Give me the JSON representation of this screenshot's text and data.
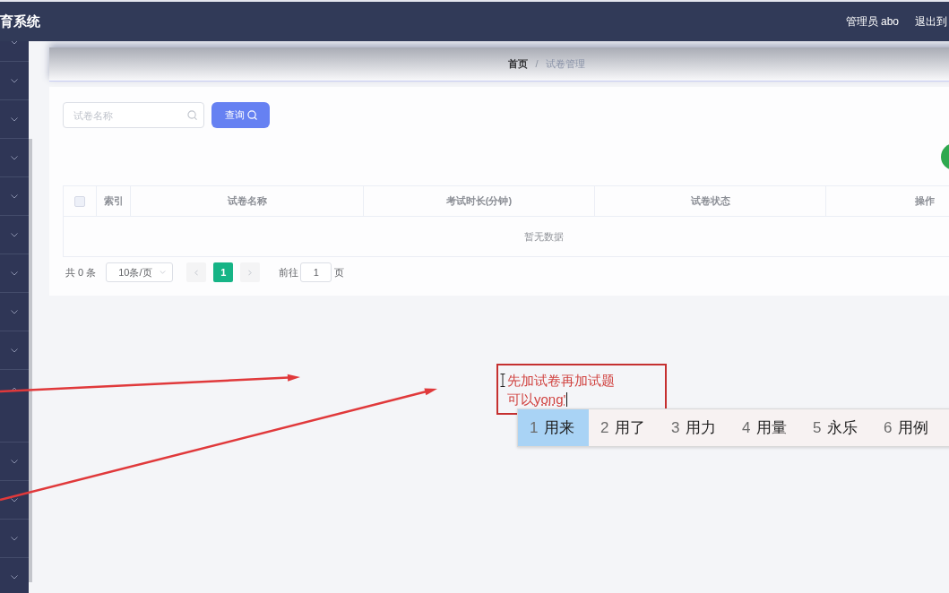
{
  "header": {
    "title": "育系统",
    "user": "管理员 abo",
    "logout": "退出到"
  },
  "sidebar": {
    "items": [
      {
        "expanded": false
      },
      {
        "expanded": false
      },
      {
        "expanded": false
      },
      {
        "expanded": false
      },
      {
        "expanded": false
      },
      {
        "expanded": false
      },
      {
        "expanded": false
      },
      {
        "expanded": false
      },
      {
        "expanded": false
      },
      {
        "expanded": true
      },
      {
        "expanded": false
      },
      {
        "expanded": false
      },
      {
        "expanded": false
      },
      {
        "expanded": false
      }
    ]
  },
  "breadcrumb": {
    "items": [
      "首页",
      "试卷管理"
    ],
    "separator": "/"
  },
  "search": {
    "placeholder": "试卷名称",
    "button": "查询"
  },
  "table": {
    "select_all": {
      "checked": false
    },
    "columns": [
      "索引",
      "试卷名称",
      "考试时长(分钟)",
      "试卷状态",
      "操作"
    ],
    "empty_text": "暂无数据"
  },
  "pagination": {
    "total": "共 0 条",
    "page_size": "10条/页",
    "pages": [
      {
        "label": "1",
        "selected": true
      }
    ],
    "goto_label": "前往",
    "goto_value": "1",
    "goto_unit": "页"
  },
  "annotation": {
    "lines": [
      "先加试卷再加试题",
      "可以"
    ],
    "composing": "yong'"
  },
  "ime_candidates": [
    {
      "number": "1",
      "text": "用来",
      "selected": true
    },
    {
      "number": "2",
      "text": "用了",
      "selected": false
    },
    {
      "number": "3",
      "text": "用力",
      "selected": false
    },
    {
      "number": "4",
      "text": "用量",
      "selected": false
    },
    {
      "number": "5",
      "text": "永乐",
      "selected": false
    },
    {
      "number": "6",
      "text": "用例",
      "selected": false
    }
  ]
}
